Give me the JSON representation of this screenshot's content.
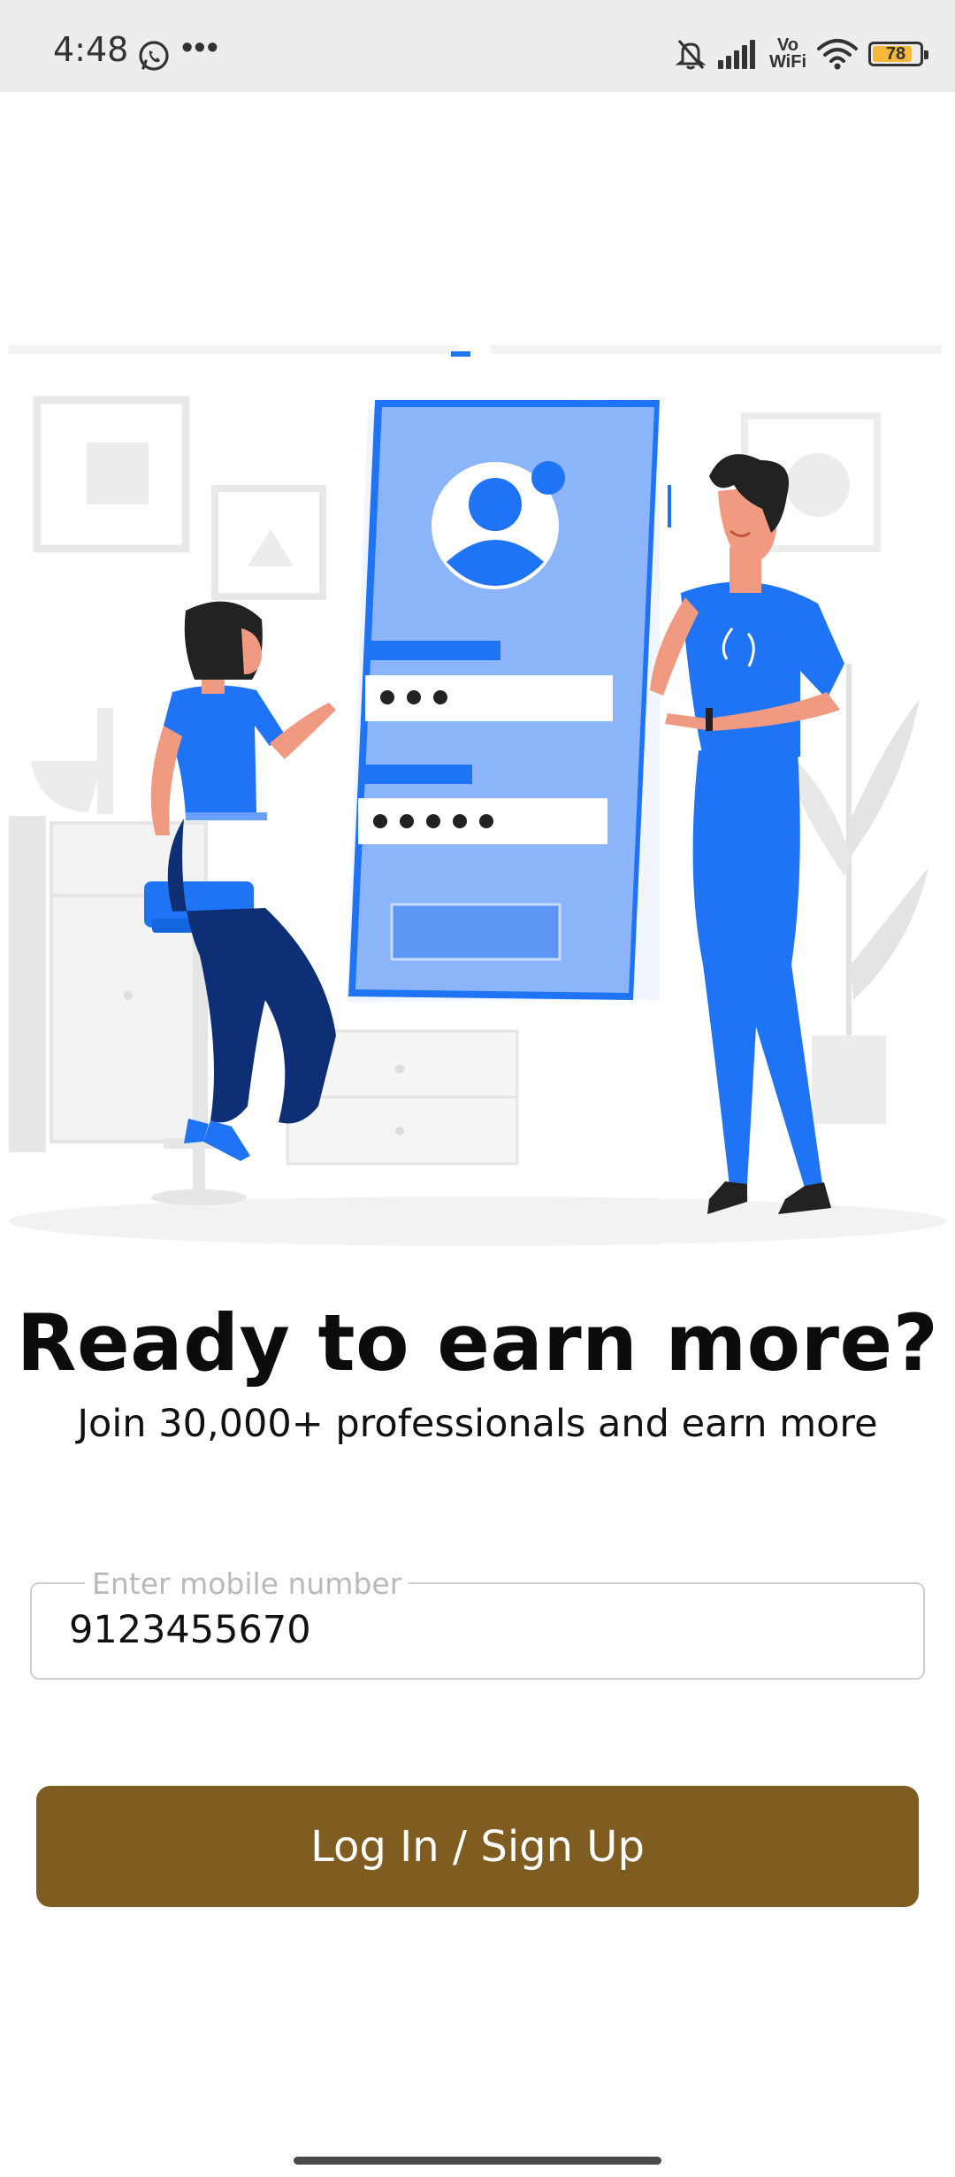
{
  "status_bar": {
    "time": "4:48",
    "more": "•••",
    "volte": [
      "Vo",
      "WiFi"
    ],
    "battery": "78",
    "icons": [
      "whatsapp-icon",
      "silent-bell-icon",
      "signal-icon",
      "wifi-icon",
      "battery-icon"
    ]
  },
  "main": {
    "headline": "Ready to earn more?",
    "subline": "Join 30,000+ professionals and earn more",
    "mobile_field": {
      "label": "Enter mobile number",
      "value": "9123455670"
    },
    "login_button": "Log In / Sign Up"
  },
  "colors": {
    "accent": "#7f5c20",
    "illustration_blue": "#1f74f5",
    "battery": "#f6b83a"
  }
}
